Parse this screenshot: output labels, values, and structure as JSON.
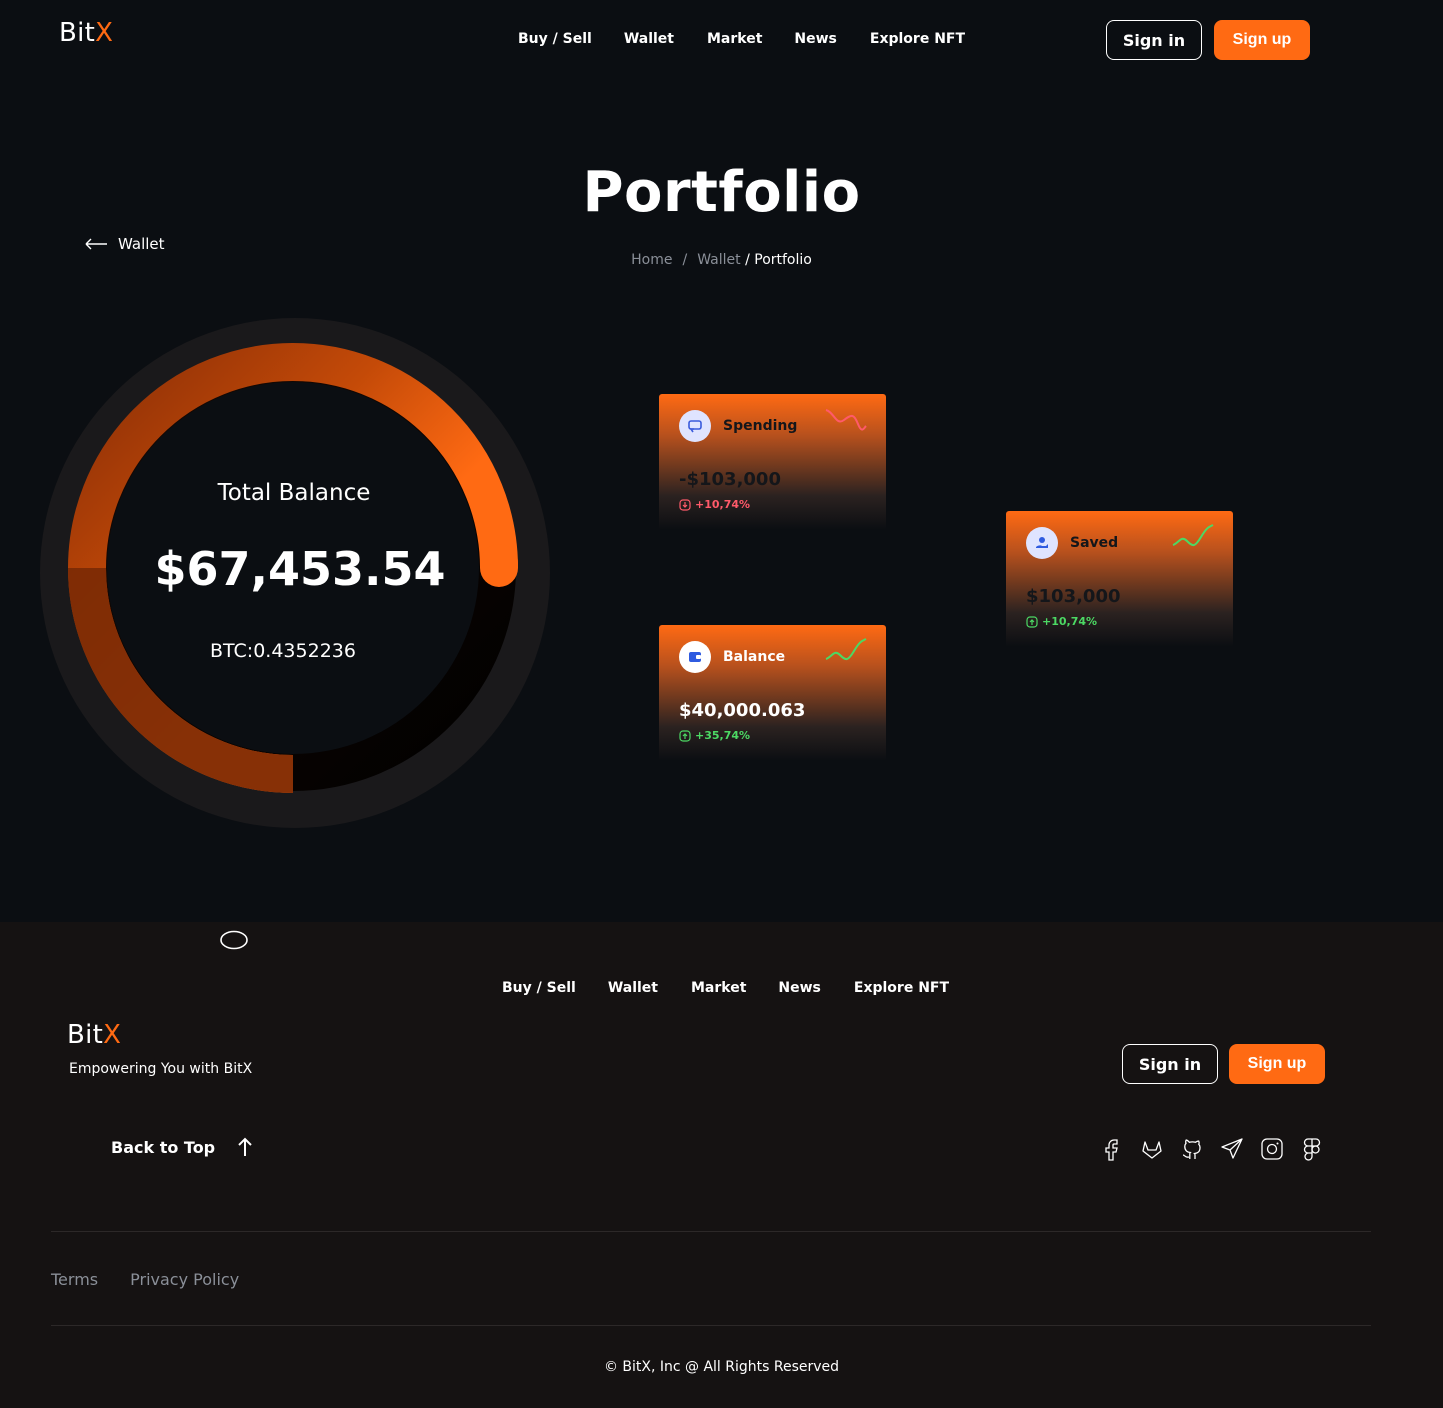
{
  "header": {
    "logo_main": "Bit",
    "logo_accent": "X",
    "nav": [
      "Buy / Sell",
      "Wallet",
      "Market",
      "News",
      "Explore NFT"
    ],
    "signin": "Sign in",
    "signup": "Sign up"
  },
  "page": {
    "title": "Portfolio",
    "back_label": "Wallet",
    "breadcrumb": [
      "Home",
      "/",
      "Wallet",
      "/ Portfolio"
    ]
  },
  "balance": {
    "label": "Total Balance",
    "amount": "$67,453.54",
    "btc": "BTC:0.4352236"
  },
  "cards": [
    {
      "label": "Spending",
      "amount": "-$103,000",
      "change": "+10,74%",
      "trend": "down",
      "color": "#ff5a6a",
      "icon": "wallet-transfer-icon"
    },
    {
      "label": "Balance",
      "amount": "$40,000.063",
      "change": "+35,74%",
      "trend": "up",
      "color": "#4cd964",
      "icon": "wallet-icon"
    },
    {
      "label": "Saved",
      "amount": "$103,000",
      "change": "+10,74%",
      "trend": "up",
      "color": "#4cd964",
      "icon": "savings-icon"
    }
  ],
  "footer": {
    "nav": [
      "Buy / Sell",
      "Wallet",
      "Market",
      "News",
      "Explore NFT"
    ],
    "logo_main": "Bit",
    "logo_accent": "X",
    "tagline": "Empowering You with BitX",
    "signin": "Sign in",
    "signup": "Sign up",
    "back_to_top": "Back to Top",
    "social_icons": [
      "facebook-icon",
      "gitlab-icon",
      "github-icon",
      "telegram-icon",
      "instagram-icon",
      "figma-icon"
    ],
    "terms": "Terms",
    "privacy": "Privacy Policy",
    "copyright": "© BitX, Inc @ All Rights Reserved"
  },
  "colors": {
    "accent": "#ff6a13",
    "background": "#0b0e12",
    "footer_bg": "#151212"
  }
}
